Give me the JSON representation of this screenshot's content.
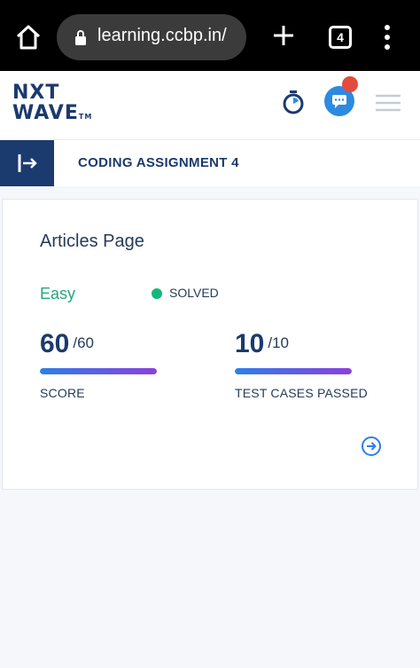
{
  "browser": {
    "url": "learning.ccbp.in/",
    "tab_count": "4",
    "icons": [
      "home-icon",
      "lock-icon",
      "plus-icon",
      "tabs-icon",
      "more-vertical-icon"
    ]
  },
  "header": {
    "logo_line1": "NXT",
    "logo_line2": "WAVE",
    "logo_tm": "TM",
    "icons": [
      "stopwatch-icon",
      "chat-icon",
      "notification-badge",
      "hamburger-menu-icon"
    ],
    "brand_color": "#1b3a6e",
    "chat_color": "#2d8ae0",
    "badge_color": "#e34b3c"
  },
  "assignment": {
    "title": "CODING ASSIGNMENT 4",
    "collapse_icon": "sidebar-expand-icon"
  },
  "card": {
    "title": "Articles Page",
    "difficulty": "Easy",
    "difficulty_color": "#26a77b",
    "status": "SOLVED",
    "status_color": "#14b87a",
    "score": {
      "value": "60",
      "total": "/60",
      "label": "SCORE",
      "progress": 1.0
    },
    "tests": {
      "value": "10",
      "total": "/10",
      "label": "TEST CASES PASSED",
      "progress": 1.0
    },
    "next_icon": "arrow-right-circle-icon"
  }
}
